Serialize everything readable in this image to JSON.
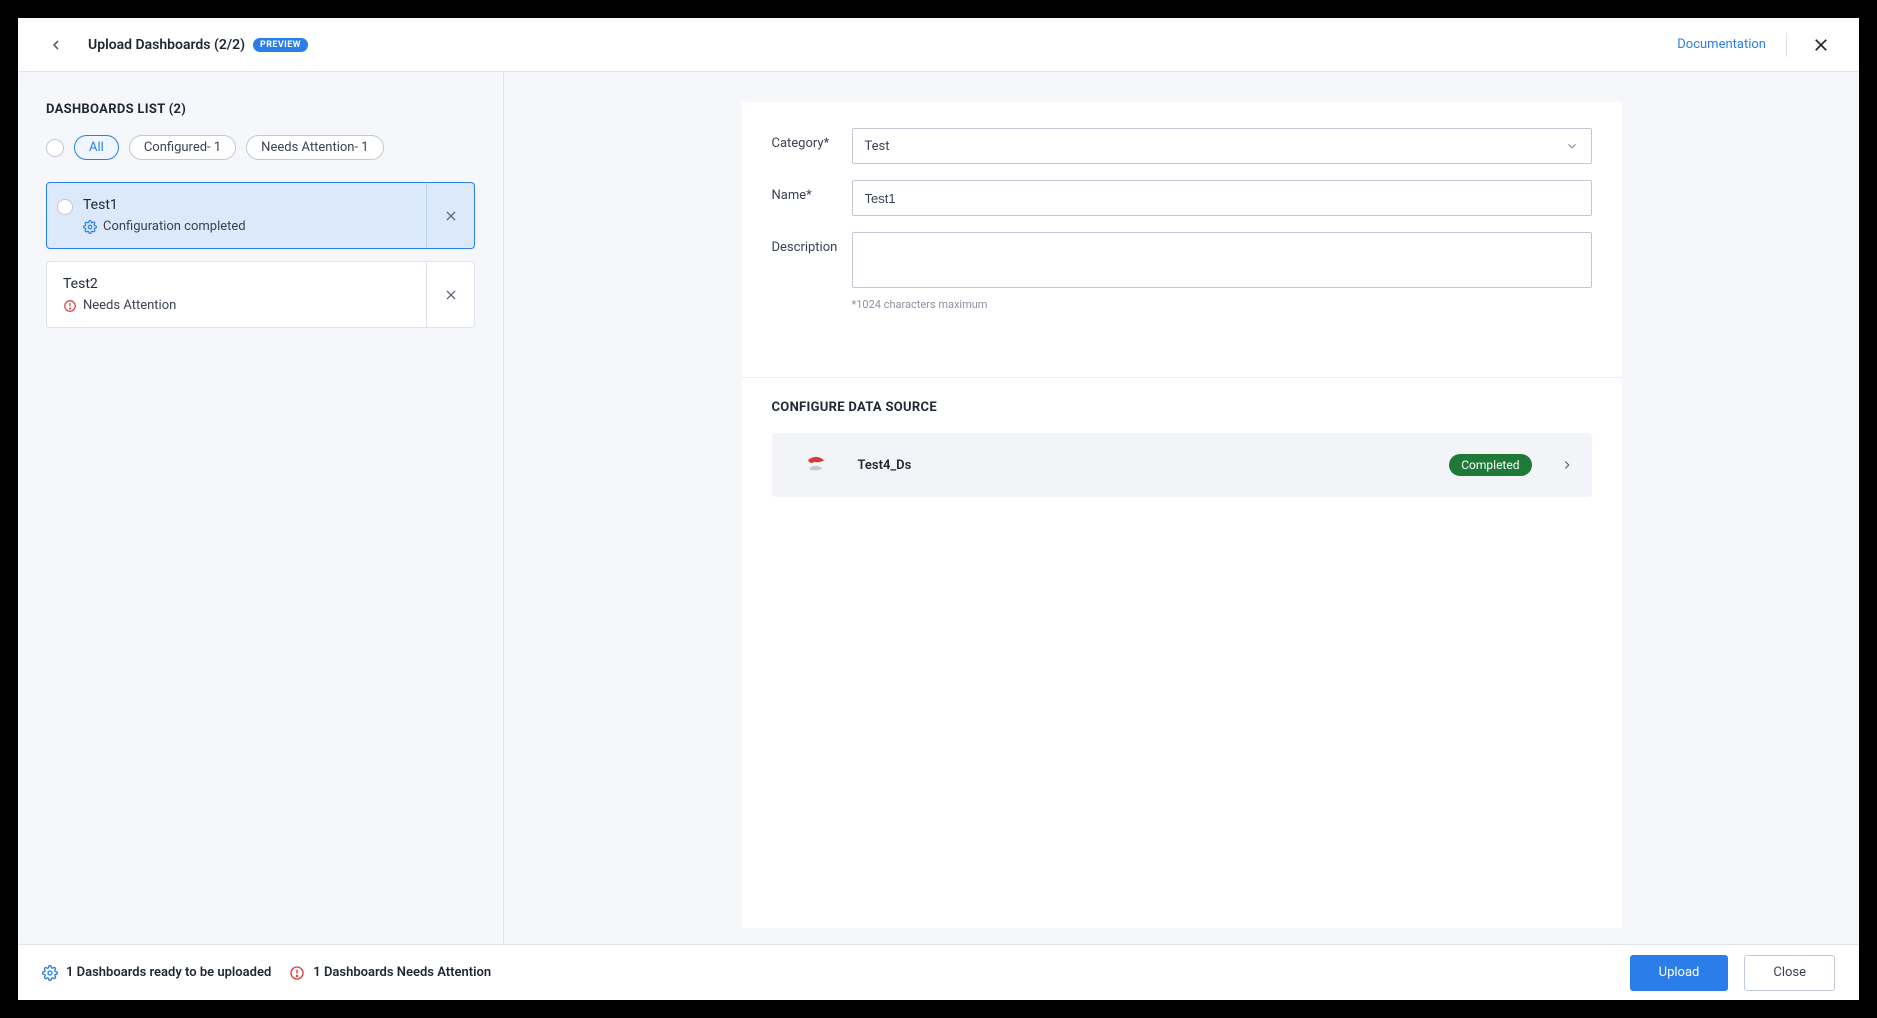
{
  "header": {
    "title": "Upload Dashboards (2/2)",
    "preview_badge": "PREVIEW",
    "documentation_label": "Documentation"
  },
  "sidebar": {
    "list_title": "DASHBOARDS LIST (2)",
    "filters": {
      "all": "All",
      "configured": "Configured- 1",
      "needs_attention": "Needs Attention- 1"
    },
    "items": [
      {
        "name": "Test1",
        "status_label": "Configuration completed",
        "status_type": "ok",
        "selected": true
      },
      {
        "name": "Test2",
        "status_label": "Needs Attention",
        "status_type": "warn",
        "selected": false
      }
    ]
  },
  "form": {
    "category_label": "Category*",
    "category_value": "Test",
    "name_label": "Name*",
    "name_value": "Test1",
    "description_label": "Description",
    "description_value": "",
    "description_helper": "*1024 characters maximum"
  },
  "data_source": {
    "section_title": "CONFIGURE DATA SOURCE",
    "name": "Test4_Ds",
    "status_label": "Completed"
  },
  "footer": {
    "ready_text": "1 Dashboards ready to be uploaded",
    "attention_text": "1 Dashboards Needs Attention",
    "upload_label": "Upload",
    "close_label": "Close"
  }
}
